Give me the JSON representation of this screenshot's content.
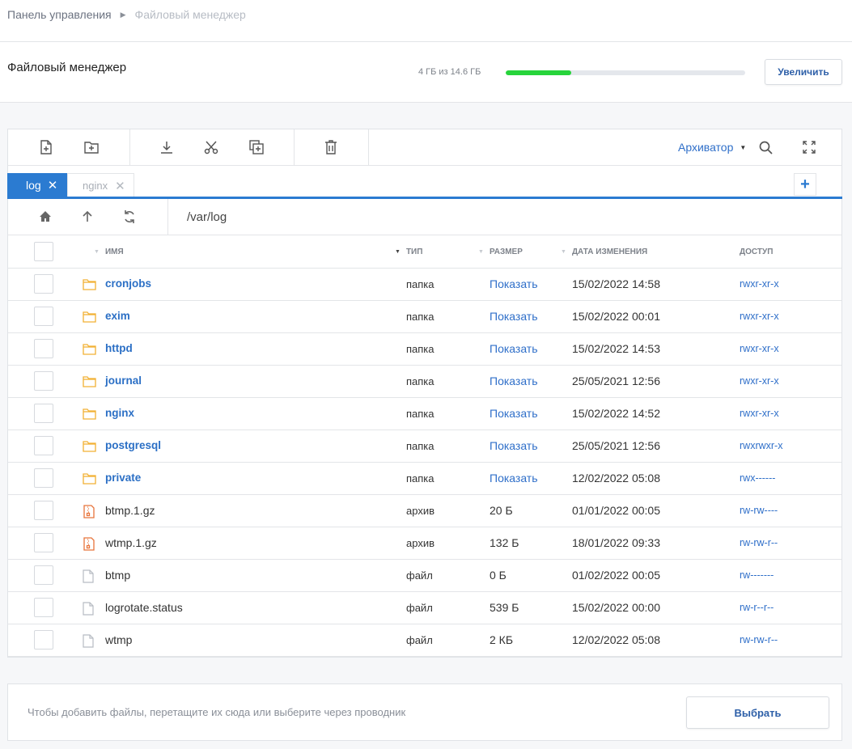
{
  "breadcrumb": {
    "root": "Панель управления",
    "current": "Файловый менеджер"
  },
  "header": {
    "title": "Файловый менеджер",
    "quota_text": "4 ГБ из 14.6 ГБ",
    "quota_fraction": 0.274,
    "grow_button": "Увеличить"
  },
  "toolbar": {
    "icons": [
      "new-file-icon",
      "new-folder-icon",
      "download-icon",
      "cut-icon",
      "copy-icon",
      "delete-icon",
      "search-icon",
      "fullscreen-icon"
    ],
    "archiver_label": "Архиватор"
  },
  "tabs": {
    "active": "log",
    "inactive": "nginx"
  },
  "path": {
    "prefix": "/var/",
    "last": "log"
  },
  "columns": {
    "name": "ИМЯ",
    "type": "ТИП",
    "size": "РАЗМЕР",
    "date": "ДАТА ИЗМЕНЕНИЯ",
    "access": "ДОСТУП"
  },
  "files": [
    {
      "name": "cronjobs",
      "kind": "dir",
      "type": "папка",
      "size": "Показать",
      "date": "15/02/2022 14:58",
      "perm": "rwxr-xr-x"
    },
    {
      "name": "exim",
      "kind": "dir",
      "type": "папка",
      "size": "Показать",
      "date": "15/02/2022 00:01",
      "perm": "rwxr-xr-x"
    },
    {
      "name": "httpd",
      "kind": "dir",
      "type": "папка",
      "size": "Показать",
      "date": "15/02/2022 14:53",
      "perm": "rwxr-xr-x"
    },
    {
      "name": "journal",
      "kind": "dir",
      "type": "папка",
      "size": "Показать",
      "date": "25/05/2021 12:56",
      "perm": "rwxr-xr-x"
    },
    {
      "name": "nginx",
      "kind": "dir",
      "type": "папка",
      "size": "Показать",
      "date": "15/02/2022 14:52",
      "perm": "rwxr-xr-x"
    },
    {
      "name": "postgresql",
      "kind": "dir",
      "type": "папка",
      "size": "Показать",
      "date": "25/05/2021 12:56",
      "perm": "rwxrwxr-x"
    },
    {
      "name": "private",
      "kind": "dir",
      "type": "папка",
      "size": "Показать",
      "date": "12/02/2022 05:08",
      "perm": "rwx------"
    },
    {
      "name": "btmp.1.gz",
      "kind": "archive",
      "type": "архив",
      "size": "20 Б",
      "date": "01/01/2022 00:05",
      "perm": "rw-rw----"
    },
    {
      "name": "wtmp.1.gz",
      "kind": "archive",
      "type": "архив",
      "size": "132 Б",
      "date": "18/01/2022 09:33",
      "perm": "rw-rw-r--"
    },
    {
      "name": "btmp",
      "kind": "file",
      "type": "файл",
      "size": "0 Б",
      "date": "01/02/2022 00:05",
      "perm": "rw-------"
    },
    {
      "name": "logrotate.status",
      "kind": "file",
      "type": "файл",
      "size": "539 Б",
      "date": "15/02/2022 00:00",
      "perm": "rw-r--r--"
    },
    {
      "name": "wtmp",
      "kind": "file",
      "type": "файл",
      "size": "2 КБ",
      "date": "12/02/2022 05:08",
      "perm": "rw-rw-r--"
    }
  ],
  "dropzone": {
    "hint": "Чтобы добавить файлы, перетащите их сюда или выберите через проводник",
    "button": "Выбрать"
  },
  "colors": {
    "accent": "#2b7bd1",
    "link": "#2f6fc9",
    "progress": "#27d43b",
    "folder": "#f2b134",
    "archive": "#e8743b"
  }
}
